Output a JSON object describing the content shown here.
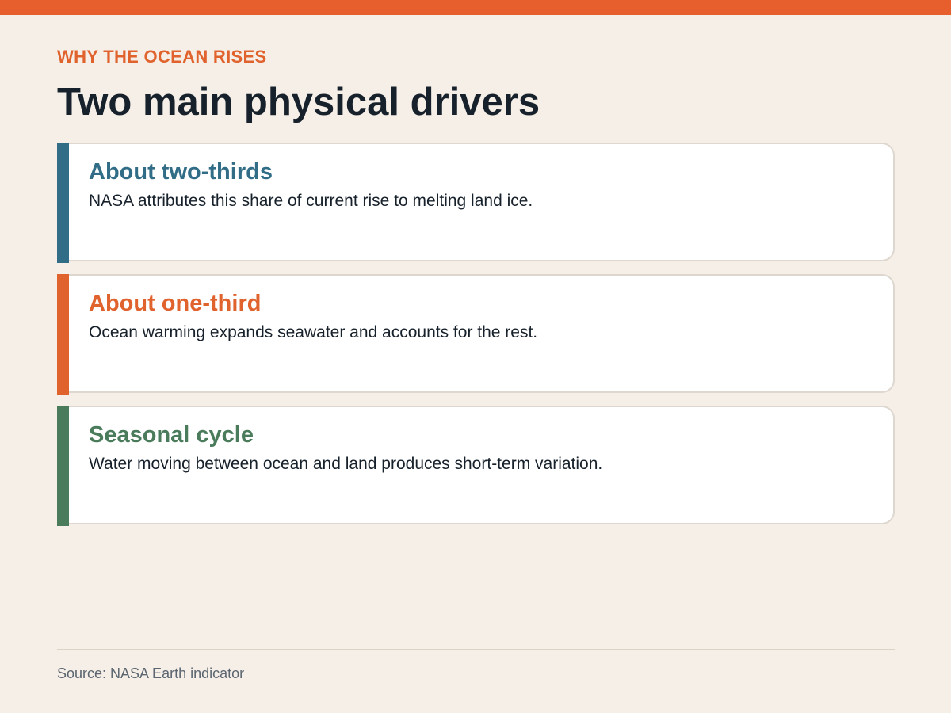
{
  "header": {
    "eyebrow": "WHY THE OCEAN RISES",
    "title": "Two main physical drivers"
  },
  "cards": [
    {
      "heading": "About two-thirds",
      "body": "NASA attributes this share of current rise to melting land ice.",
      "color": "#316d86"
    },
    {
      "heading": "About one-third",
      "body": "Ocean warming expands seawater and accounts for the rest.",
      "color": "#e0622c"
    },
    {
      "heading": "Seasonal cycle",
      "body": "Water moving between ocean and land produces short-term variation.",
      "color": "#4a7b5b"
    }
  ],
  "footer": {
    "source": "Source: NASA Earth indicator"
  },
  "colors": {
    "accent": "#e65f2c",
    "background": "#f6efe8",
    "text": "#17212b"
  }
}
